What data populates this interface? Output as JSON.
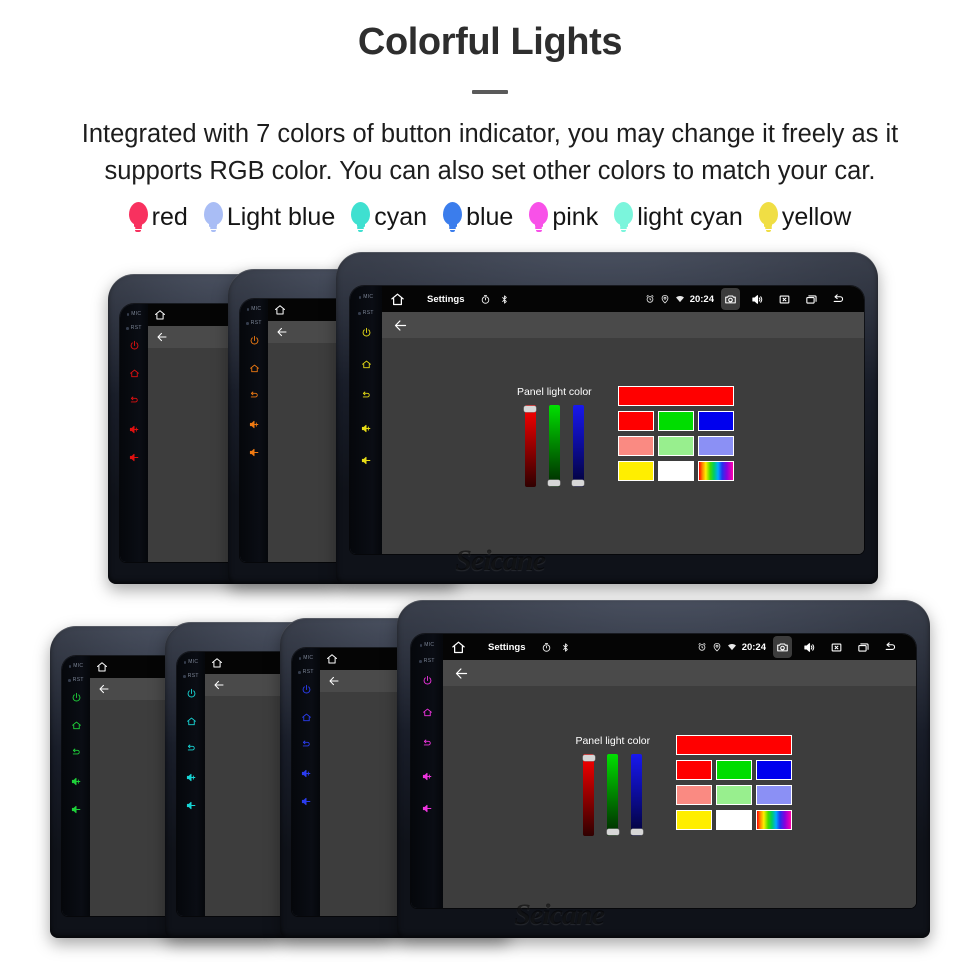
{
  "header": {
    "title": "Colorful Lights",
    "paragraph": "Integrated with 7 colors of button indicator, you may change it freely as it supports RGB color. You can also set other colors to match your car."
  },
  "legend": {
    "items": [
      {
        "label": "red",
        "color": "#f8315f",
        "icon": "bulb-icon"
      },
      {
        "label": "Light blue",
        "color": "#a9bdf5",
        "icon": "bulb-icon"
      },
      {
        "label": "cyan",
        "color": "#3fe0d0",
        "icon": "bulb-icon"
      },
      {
        "label": "blue",
        "color": "#3b7dec",
        "icon": "bulb-icon"
      },
      {
        "label": "pink",
        "color": "#f851e8",
        "icon": "bulb-icon"
      },
      {
        "label": "light cyan",
        "color": "#7bf5dc",
        "icon": "bulb-icon"
      },
      {
        "label": "yellow",
        "color": "#f0de44",
        "icon": "bulb-icon"
      }
    ]
  },
  "device": {
    "watermark": "Seicane",
    "side_buttons": {
      "mic_label": "MIC",
      "rst_label": "RST",
      "icons": [
        "power-icon",
        "home-icon",
        "back-icon",
        "volume-up-icon",
        "volume-down-icon"
      ]
    },
    "statusbar": {
      "home_icon": "home-icon",
      "title": "Settings",
      "left_icons": [
        "timer-icon",
        "bluetooth-icon"
      ],
      "right_icons": [
        "alarm-icon",
        "location-icon",
        "wifi-icon"
      ],
      "clock": "20:24",
      "tray_icons": [
        "camera-icon",
        "speaker-icon",
        "close-box-icon",
        "recents-icon",
        "back-arrow-icon"
      ],
      "highlighted_icon": "camera-icon"
    },
    "actionbar": {
      "back_icon": "back-arrow-icon"
    },
    "panel": {
      "label": "Panel light color",
      "sliders": [
        {
          "name": "red",
          "color": "#ff0000",
          "value": 100,
          "thumb_position": "top"
        },
        {
          "name": "green",
          "color": "#00e000",
          "value": 0,
          "thumb_position": "bottom"
        },
        {
          "name": "blue",
          "color": "#1818ee",
          "value": 0,
          "thumb_position": "bottom"
        }
      ],
      "preview_color": "#ff0000",
      "swatch_rows": [
        [
          "#ff0000",
          "#00dd00",
          "#0000ee"
        ],
        [
          "#fa8a82",
          "#98ef8e",
          "#8b90f5"
        ],
        [
          "#ffee00",
          "#ffffff",
          "rainbow"
        ]
      ]
    }
  },
  "groups": [
    {
      "name": "top-row",
      "units": [
        {
          "button_color": "#e01010",
          "size": "small"
        },
        {
          "button_color": "#ef7a12",
          "size": "small"
        },
        {
          "button_color": "#e8dd16",
          "size": "large"
        }
      ]
    },
    {
      "name": "bottom-row",
      "units": [
        {
          "button_color": "#1fd13a",
          "size": "small"
        },
        {
          "button_color": "#17d6d6",
          "size": "small"
        },
        {
          "button_color": "#2b3df0",
          "size": "small"
        },
        {
          "button_color": "#ef34df",
          "size": "large"
        }
      ]
    }
  ]
}
